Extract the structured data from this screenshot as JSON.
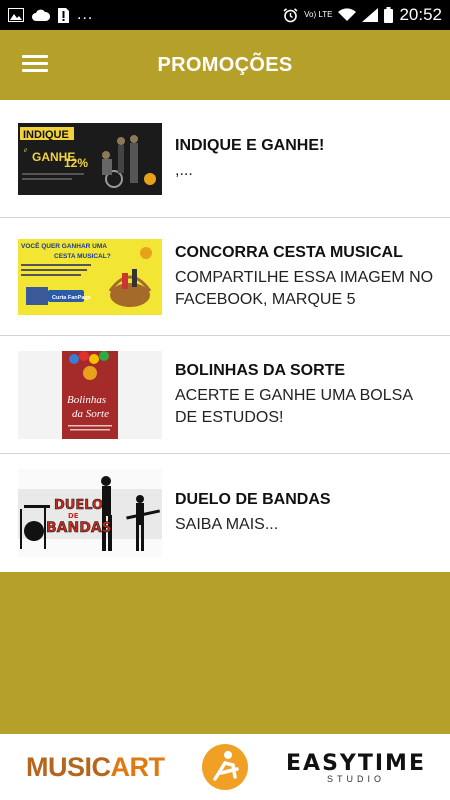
{
  "status_bar": {
    "time": "20:52",
    "network": "Vo) LTE",
    "dots": "..."
  },
  "app_bar": {
    "title": "PROMOÇÕES"
  },
  "promotions": [
    {
      "title": "INDIQUE E GANHE!",
      "desc": ",..."
    },
    {
      "title": "CONCORRA CESTA MUSICAL",
      "desc": "COMPARTILHE ESSA IMAGEM NO FACEBOOK, MARQUE 5"
    },
    {
      "title": "BOLINHAS DA SORTE",
      "desc": "ACERTE E GANHE UMA BOLSA DE ESTUDOS!"
    },
    {
      "title": "DUELO DE BANDAS",
      "desc": "SAIBA MAIS..."
    }
  ],
  "thumbnails": {
    "t1": {
      "line1": "INDIQUE",
      "line2": "GANHE",
      "percent": "12%"
    },
    "t2": {
      "line1": "VOCÊ QUER GANHAR UMA",
      "line2": "CESTA MUSICAL?",
      "btn": "Curta FanPage"
    },
    "t3": {
      "line1": "Bolinhas",
      "line2": "da Sorte"
    },
    "t4": {
      "line1": "DUELO",
      "line2": "DE",
      "line3": "BANDAS"
    }
  },
  "footer": {
    "musicart_a": "MUSIC",
    "musicart_b": "ART",
    "easytime": "EASYTIME",
    "easytime_sub": "STUDIO"
  },
  "colors": {
    "brand": "#b5a02a",
    "text": "#111111"
  }
}
